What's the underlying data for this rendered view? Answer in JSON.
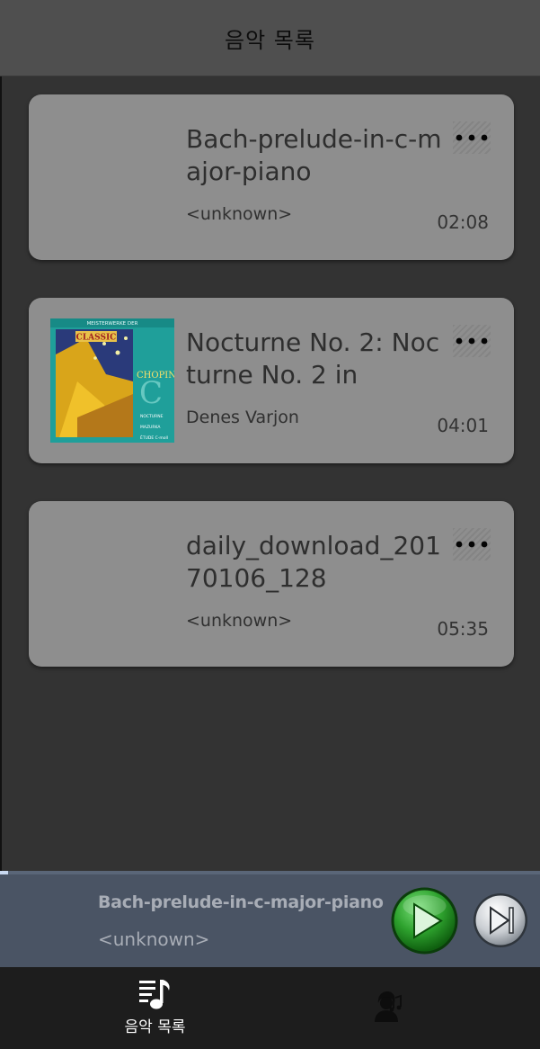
{
  "header": {
    "title": "음악 목록"
  },
  "songs": [
    {
      "title": "Bach-prelude-in-c-major-piano",
      "artist": "<unknown>",
      "duration": "02:08",
      "has_art": false
    },
    {
      "title": "Nocturne No. 2: Nocturne No. 2 in",
      "artist": "Denes Varjon",
      "duration": "04:01",
      "has_art": true,
      "art_text": {
        "top": "MEISTERWERKE DER",
        "brand": "CLASSIC",
        "composer": "CHOPIN",
        "tracks": [
          "NOCTURNE",
          "MAZURKA",
          "ÉTUDE C-moll"
        ]
      }
    },
    {
      "title": "daily_download_20170106_128",
      "artist": "<unknown>",
      "duration": "05:35",
      "has_art": false
    }
  ],
  "player": {
    "title": "Bach-prelude-in-c-major-piano",
    "artist": "<unknown>",
    "progress_fraction": 0.015,
    "play_icon": "play-icon",
    "next_icon": "skip-next-icon"
  },
  "nav": {
    "items": [
      {
        "label": "음악 목록",
        "icon": "music-list-icon"
      },
      {
        "label": "",
        "icon": "musician-icon"
      }
    ]
  },
  "colors": {
    "card": "#8e8e8e",
    "background": "#333333",
    "player_bar": "#4a5464",
    "play_button": "#2ea22e",
    "nav_bar": "#1d1d1d"
  }
}
